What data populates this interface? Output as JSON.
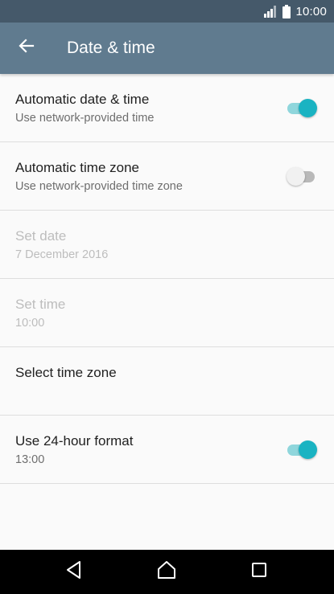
{
  "status_bar": {
    "time": "10:00",
    "icons": [
      "signal-icon",
      "battery-icon"
    ]
  },
  "app_bar": {
    "title": "Date & time",
    "back_icon": "arrow-left-icon"
  },
  "settings": [
    {
      "title": "Automatic date & time",
      "subtitle": "Use network-provided time",
      "has_switch": true,
      "switch_on": true,
      "enabled": true
    },
    {
      "title": "Automatic time zone",
      "subtitle": "Use network-provided time zone",
      "has_switch": true,
      "switch_on": false,
      "enabled": true
    },
    {
      "title": "Set date",
      "subtitle": "7 December 2016",
      "has_switch": false,
      "enabled": false
    },
    {
      "title": "Set time",
      "subtitle": "10:00",
      "has_switch": false,
      "enabled": false
    },
    {
      "title": "Select time zone",
      "subtitle": "",
      "has_switch": false,
      "enabled": true
    },
    {
      "title": "Use 24-hour format",
      "subtitle": "13:00",
      "has_switch": true,
      "switch_on": true,
      "enabled": true
    }
  ],
  "nav_bar": {
    "icons": [
      "nav-back-icon",
      "nav-home-icon",
      "nav-recent-icon"
    ]
  },
  "colors": {
    "status_bar": "#45596a",
    "app_bar": "#607b8f",
    "accent": "#1ab3c2",
    "background": "#fafafa"
  }
}
